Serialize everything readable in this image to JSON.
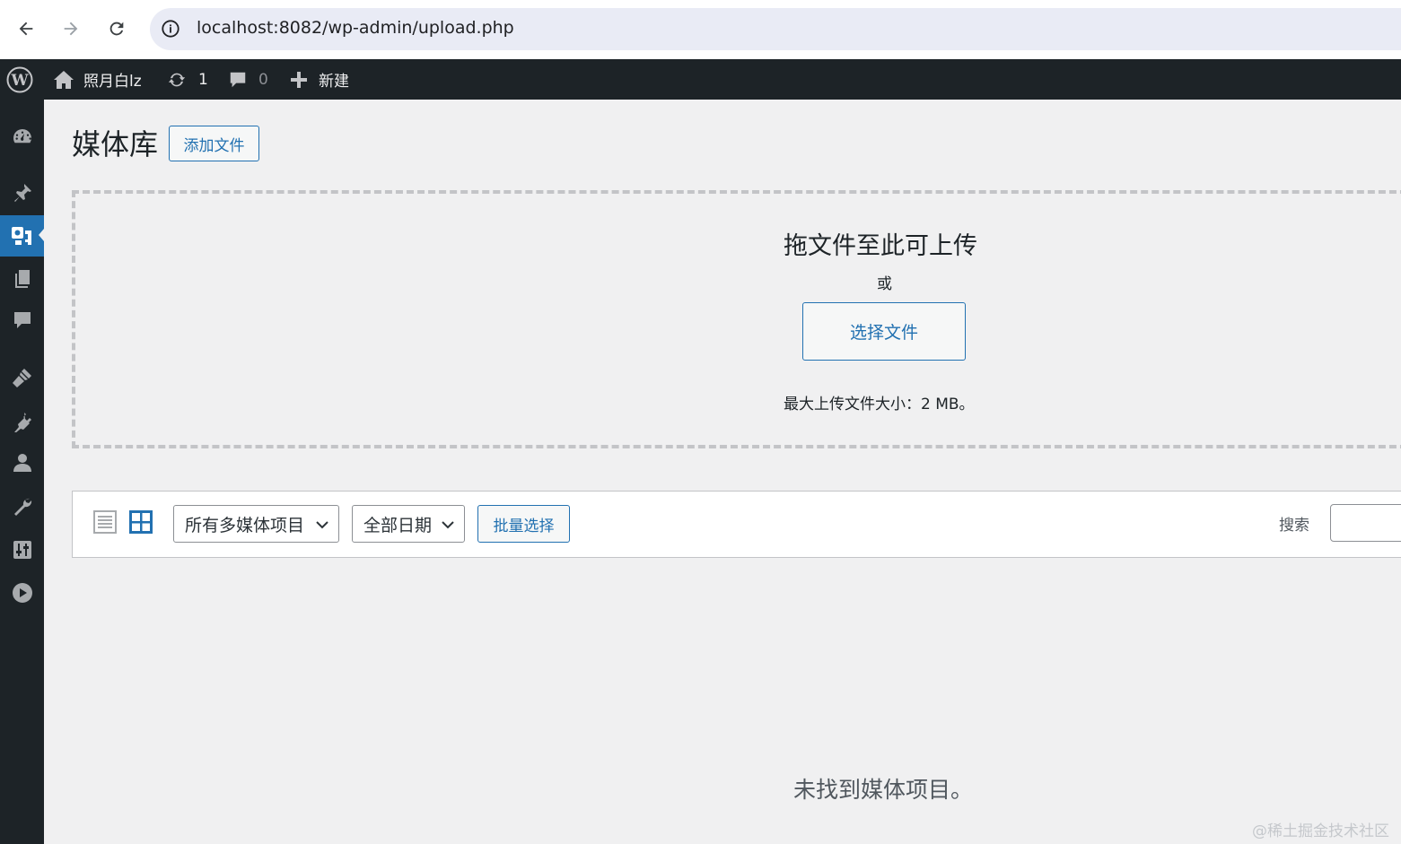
{
  "browser": {
    "url": "localhost:8082/wp-admin/upload.php"
  },
  "admin_bar": {
    "site_name": "照月白lz",
    "updates_count": "1",
    "comments_count": "0",
    "new_label": "新建"
  },
  "sidebar": {
    "items": [
      {
        "icon": "dashboard-icon"
      },
      {
        "icon": "posts-pin-icon"
      },
      {
        "icon": "media-icon",
        "active": true
      },
      {
        "icon": "pages-icon"
      },
      {
        "icon": "comments-icon"
      },
      {
        "icon": "appearance-brush-icon"
      },
      {
        "icon": "plugins-icon"
      },
      {
        "icon": "users-icon"
      },
      {
        "icon": "tools-wrench-icon"
      },
      {
        "icon": "settings-sliders-icon"
      },
      {
        "icon": "collapse-play-icon"
      }
    ]
  },
  "page": {
    "title": "媒体库",
    "add_button": "添加文件"
  },
  "uploader": {
    "title": "拖文件至此可上传",
    "or": "或",
    "select_button": "选择文件",
    "max_size": "最大上传文件大小：2 MB。"
  },
  "toolbar": {
    "media_type_filter": "所有多媒体项目",
    "date_filter": "全部日期",
    "bulk_select": "批量选择",
    "search_label": "搜索",
    "search_value": ""
  },
  "empty_message": "未找到媒体项目。",
  "watermark": "@稀土掘金技术社区",
  "colors": {
    "admin_dark": "#1d2327",
    "accent": "#2271b1",
    "background": "#f0f0f1"
  }
}
